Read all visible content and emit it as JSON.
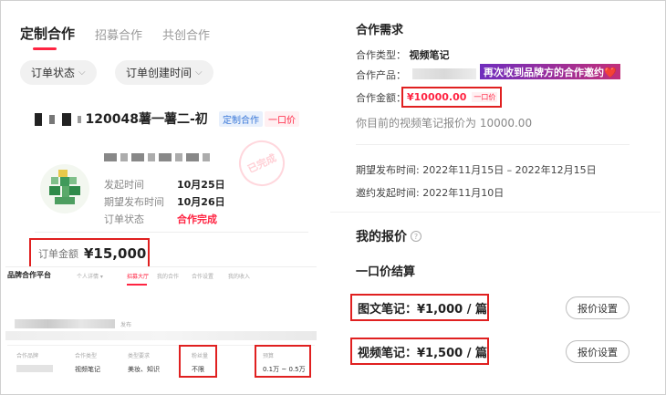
{
  "order_panel": {
    "tabs": [
      {
        "label": "定制合作",
        "active": true
      },
      {
        "label": "招募合作",
        "active": false
      },
      {
        "label": "共创合作",
        "active": false
      }
    ],
    "filters": [
      {
        "label": "订单状态"
      },
      {
        "label": "订单创建时间"
      }
    ],
    "order": {
      "title_visible": "120048薯一薯二-初",
      "badge_type": "定制合作",
      "badge_price": "一口价",
      "stamp": "已完成",
      "launch_label": "发起时间",
      "launch_value": "10月25日",
      "publish_label": "期望发布时间",
      "publish_value": "10月26日",
      "status_label": "订单状态",
      "status_value": "合作完成",
      "amount_label": "订单金额",
      "amount_value": "¥15,000"
    }
  },
  "platform_panel": {
    "title": "品牌合作平台",
    "nav": [
      {
        "label": "个人详情 ▾",
        "active": false
      },
      {
        "label": "招募大厅",
        "active": true
      },
      {
        "label": "我的合作",
        "active": false
      },
      {
        "label": "合作设置",
        "active": false
      },
      {
        "label": "我的收入",
        "active": false
      }
    ],
    "blur_suffix": "发布",
    "columns": [
      {
        "header": "合作品牌",
        "value": ""
      },
      {
        "header": "合作类型",
        "value": "视频笔记"
      },
      {
        "header": "类型要求",
        "value": "美妆、知识"
      },
      {
        "header": "粉丝量",
        "value": "不限"
      },
      {
        "header": "预算",
        "value": "0.1万 ~ 0.5万"
      }
    ]
  },
  "requirement_panel": {
    "title": "合作需求",
    "type_label": "合作类型：",
    "type_value": "视频笔记",
    "product_label": "合作产品：",
    "invite_tag": "再次收到品牌方的合作邀约❤️",
    "amount_label": "合作金额：",
    "amount_value": "¥10000.00",
    "amount_tag": "一口价",
    "quote_note": "你目前的视频笔记报价为 10000.00",
    "publish_time": "期望发布时间: 2022年11月15日 – 2022年12月15日",
    "invite_time": "邀约发起时间: 2022年11月10日"
  },
  "quote_panel": {
    "title": "我的报价",
    "subtitle": "一口价结算",
    "items": [
      {
        "label": "图文笔记：",
        "price": "¥1,000 / 篇",
        "button": "报价设置"
      },
      {
        "label": "视频笔记：",
        "price": "¥1,500 / 篇",
        "button": "报价设置"
      }
    ]
  },
  "colors": {
    "accent": "#ff2442",
    "highlight_box": "#e02020",
    "link_blue": "#3a78d8"
  }
}
